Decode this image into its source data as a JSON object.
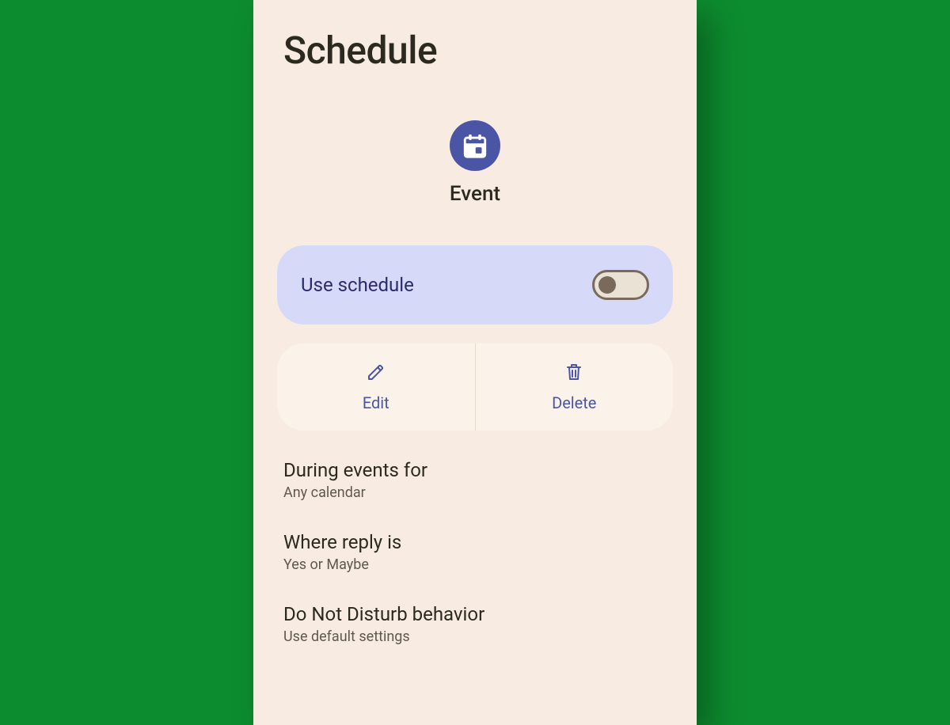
{
  "header": {
    "title": "Schedule"
  },
  "event": {
    "label": "Event"
  },
  "use_schedule": {
    "label": "Use schedule",
    "on": false
  },
  "actions": {
    "edit": "Edit",
    "delete": "Delete"
  },
  "settings": [
    {
      "title": "During events for",
      "subtitle": "Any calendar"
    },
    {
      "title": "Where reply is",
      "subtitle": "Yes or Maybe"
    },
    {
      "title": "Do Not Disturb behavior",
      "subtitle": "Use default settings"
    }
  ],
  "colors": {
    "page_bg": "#0d8c2f",
    "panel_bg": "#f8ece2",
    "accent": "#4b55a6",
    "card_bg": "#d7d9f8",
    "action_bg": "#fbf3ea"
  }
}
